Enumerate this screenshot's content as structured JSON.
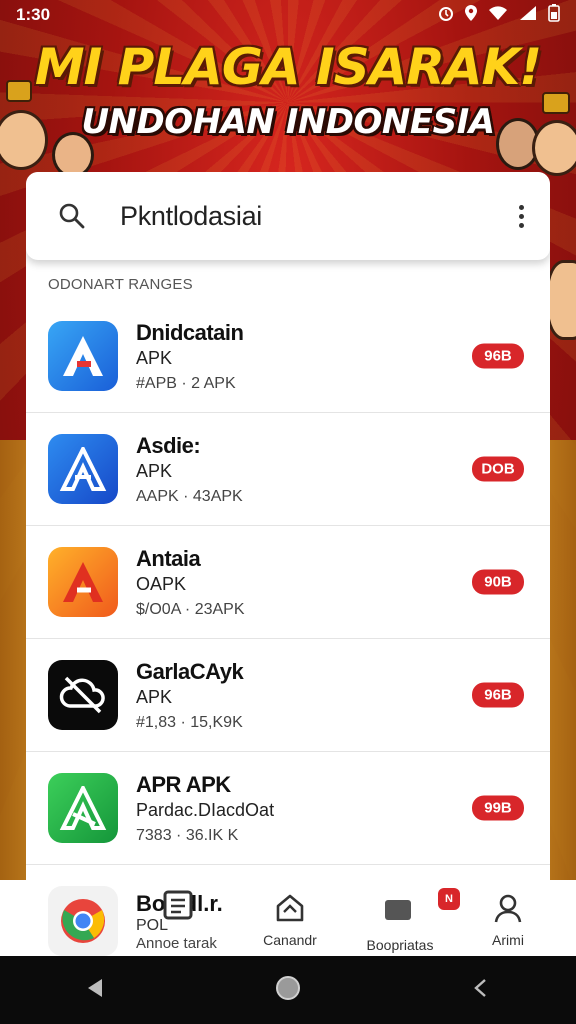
{
  "status_bar": {
    "time": "1:30"
  },
  "banner": {
    "headline": "MI PLAGA ISARAK!",
    "subheadline": "UNDOHAN INDONESIA"
  },
  "search": {
    "query": "Pkntlodasiai"
  },
  "section": {
    "label": "ODONART RANGES"
  },
  "apps": [
    {
      "name": "Dnidcatain",
      "sub": "APK",
      "meta": "#APB · 2 APK",
      "size": "96B",
      "icon": "a-letter-icon",
      "color": "#1e7ee6"
    },
    {
      "name": "Asdie:",
      "sub": "APK",
      "meta": "AAPK · 43APK",
      "size": "DOB",
      "icon": "a-letter-icon",
      "color": "#1a68d6"
    },
    {
      "name": "Antaia",
      "sub": "OAPK",
      "meta": "$/O0A · 23APK",
      "size": "90B",
      "icon": "a-letter-icon",
      "color": "#f07020"
    },
    {
      "name": "GarlaCAyk",
      "sub": "APK",
      "meta": "#1,83 · 15,K9K",
      "size": "96B",
      "icon": "cloud-slash-icon",
      "color": "#0a0a0a"
    },
    {
      "name": "APR APK",
      "sub": "Pardac.DIacdOat",
      "meta": "7383 · 36.IK K",
      "size": "99B",
      "icon": "a-letter-icon",
      "color": "#23b04a"
    }
  ],
  "partial_app": {
    "name": "Bo...dl.r.",
    "sub": "POL",
    "meta": "Annoe tarak"
  },
  "bottom_nav": {
    "tab1_label": "Canandr",
    "tab2_label": "Boopriatas",
    "tab3_label": "Arimi",
    "new_badge": "N"
  }
}
